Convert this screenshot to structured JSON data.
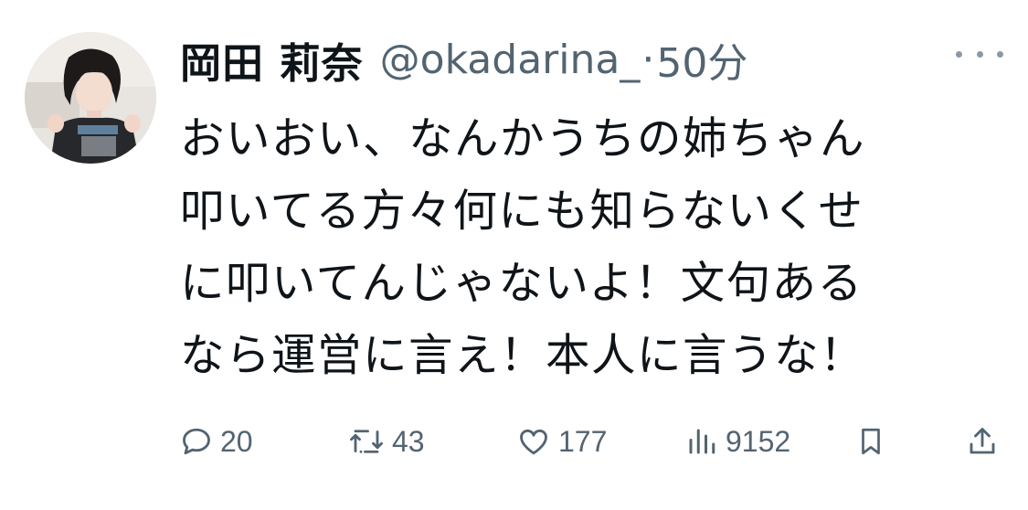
{
  "tweet": {
    "display_name": "岡田 莉奈",
    "handle": "@okadarina_",
    "separator": "·",
    "time": "50分",
    "body_lines": [
      "おいおい、なんかうちの姉ちゃん",
      "叩いてる方々何にも知らないくせ",
      "に叩いてんじゃないよ！文句ある",
      "なら運営に言え！本人に言うな！"
    ]
  },
  "actions": {
    "reply_count": "20",
    "retweet_count": "43",
    "like_count": "177",
    "views_count": "9152"
  },
  "icons": {
    "reply": "comment-icon",
    "retweet": "retweet-icon",
    "like": "heart-icon",
    "views": "bar-chart-icon",
    "bookmark": "bookmark-icon",
    "share": "share-icon",
    "more": "more-dots-icon"
  },
  "colors": {
    "text_primary": "#0f1419",
    "text_secondary": "#536471",
    "background": "#ffffff"
  }
}
